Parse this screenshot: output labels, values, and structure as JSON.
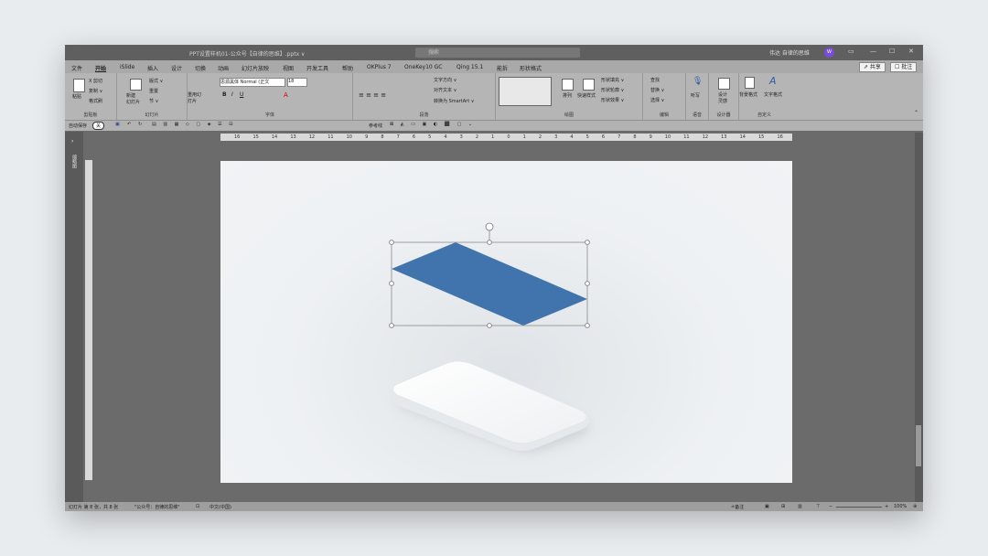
{
  "titlebar": {
    "title": "PPT设置样机01-公众号【自律的思维】.pptx ∨",
    "search_placeholder": "搜索",
    "user_name": "伟达  自律的思维",
    "avatar": "W",
    "min": "—",
    "max": "☐",
    "close": "✕",
    "restore": "▭"
  },
  "menu": {
    "tabs": [
      "文件",
      "开始",
      "iSlide",
      "插入",
      "设计",
      "切换",
      "动画",
      "幻灯片放映",
      "视图",
      "开发工具",
      "帮助",
      "OKPlus 7",
      "OneKey10 GC",
      "Qing 15.1",
      "能拆",
      "形状格式"
    ],
    "share": "⇗ 共享",
    "comment": "☐ 批注"
  },
  "ribbon": {
    "clipboard": {
      "paste": "粘贴",
      "cut": "X 剪切",
      "copy": "复制 ∨",
      "format_painter": "格式刷",
      "label": "剪贴板"
    },
    "slides": {
      "new": "新建\n幻灯片",
      "layout": "版式 ∨",
      "reset": "重置",
      "section": "节 ∨",
      "label": "幻灯片"
    },
    "font_grp": {
      "reuse": "重用幻\n灯片",
      "font_name": "思源黑体 Normal (正文",
      "font_size": "18",
      "label": "字体"
    },
    "paragraph": {
      "text_dir": "文字方向 ∨",
      "align_text": "对齐文本 ∨",
      "smartart": "转换为 SmartArt ∨",
      "label": "段落"
    },
    "drawing": {
      "arrange": "排列",
      "quick_styles": "快速样式",
      "fill": "形状填充 ∨",
      "outline": "形状轮廓 ∨",
      "effects": "形状效果 ∨",
      "label": "绘图"
    },
    "editing": {
      "find": "查找",
      "replace": "替换 ∨",
      "select": "选择 ∨",
      "label": "编辑"
    },
    "voice": {
      "dictate": "听写",
      "label": "语音"
    },
    "designer": {
      "ideas": "设计\n灵感",
      "label": "设计器"
    },
    "custom": {
      "bg": "背景格式",
      "txt": "文字格式",
      "label": "自定义"
    }
  },
  "qat": {
    "autosave": "自动保存",
    "off": "关",
    "ref_line": "参考线"
  },
  "ruler": {
    "ticks": [
      "16",
      "15",
      "14",
      "13",
      "12",
      "11",
      "10",
      "9",
      "8",
      "7",
      "6",
      "5",
      "4",
      "3",
      "2",
      "1",
      "0",
      "1",
      "2",
      "3",
      "4",
      "5",
      "6",
      "7",
      "8",
      "9",
      "10",
      "11",
      "12",
      "13",
      "14",
      "15",
      "16"
    ]
  },
  "status": {
    "slide_info": "幻灯片 第 8 张，共 8 张",
    "account": "\"公众号：自律的思维\"",
    "lang": "中文(中国)",
    "notes": "≟备注",
    "zoom": "100%"
  },
  "colors": {
    "shape_fill": "#4174ad",
    "phone": "#f7f8f9"
  }
}
